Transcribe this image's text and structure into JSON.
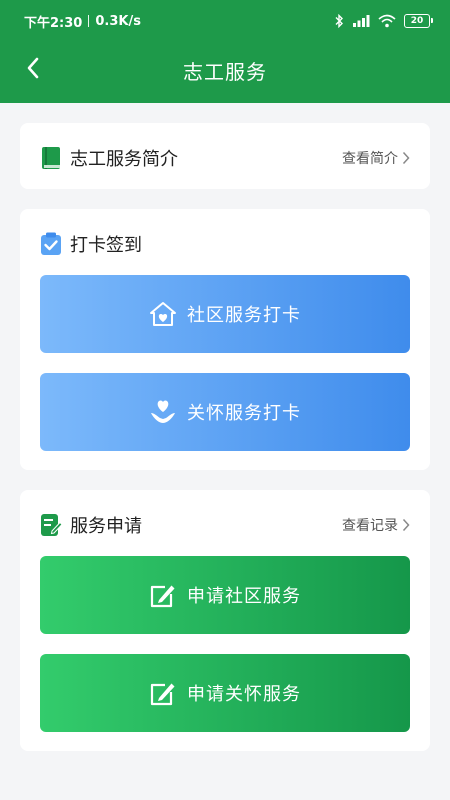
{
  "status_bar": {
    "time": "下午2:30",
    "speed": "0.3K/s",
    "battery": "20"
  },
  "header": {
    "title": "志工服务"
  },
  "intro": {
    "title": "志工服务简介",
    "link": "查看简介"
  },
  "checkin": {
    "title": "打卡签到",
    "community_button": "社区服务打卡",
    "care_button": "关怀服务打卡"
  },
  "apply": {
    "title": "服务申请",
    "link": "查看记录",
    "community_button": "申请社区服务",
    "care_button": "申请关怀服务"
  },
  "colors": {
    "header": "#1e9a4a",
    "blue_button": "#5aa3f4",
    "green_button": "#23b45a"
  }
}
